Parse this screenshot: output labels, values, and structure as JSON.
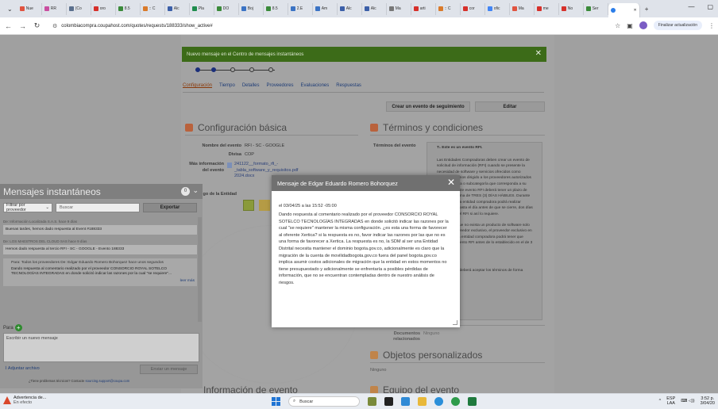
{
  "browser": {
    "tabs": [
      {
        "label": "Nue",
        "color": "#e0533f"
      },
      {
        "label": "RR",
        "color": "#c94ea0"
      },
      {
        "label": "(Co",
        "color": "#5a6f8d"
      },
      {
        "label": "oro",
        "color": "#d6302a"
      },
      {
        "label": "8.5",
        "color": "#3a8a3a"
      },
      {
        "label": ":: C",
        "color": "#d97a2a"
      },
      {
        "label": "Alc",
        "color": "#3b5fa8"
      },
      {
        "label": "Pla",
        "color": "#1e8c4d"
      },
      {
        "label": "DO",
        "color": "#3a8a3a"
      },
      {
        "label": "Boj",
        "color": "#3b73c4"
      },
      {
        "label": "8.5",
        "color": "#3a8a3a"
      },
      {
        "label": "2.E",
        "color": "#3b73c4"
      },
      {
        "label": "Am",
        "color": "#3b73c4"
      },
      {
        "label": "Alc",
        "color": "#3b5fa8"
      },
      {
        "label": "Alc",
        "color": "#3b5fa8"
      },
      {
        "label": "Ma",
        "color": "#777777"
      },
      {
        "label": "arti",
        "color": "#d6302a"
      },
      {
        "label": ":: C",
        "color": "#d97a2a"
      },
      {
        "label": "cor",
        "color": "#d6302a"
      },
      {
        "label": "ofic",
        "color": "#4285f4"
      },
      {
        "label": "Ma",
        "color": "#e0533f"
      },
      {
        "label": "me",
        "color": "#d6302a"
      },
      {
        "label": "No",
        "color": "#d6302a"
      },
      {
        "label": "Ser",
        "color": "#3a8a3a"
      }
    ],
    "active_tab_label": "",
    "new_tab": "+",
    "url": "colombiacompra.coupahost.com/quotes/requests/188333/show_active#",
    "update_button": "Finalizar actualización"
  },
  "banner": {
    "text": "Nuevo mensaje en el Centro de mensajes instantáneos",
    "close": "✕"
  },
  "wizard_nav": [
    "Configuración",
    "Tiempo",
    "Detalles",
    "Proveedores",
    "Evaluaciones",
    "Respuestas"
  ],
  "actions": {
    "follow_up": "Crear un evento de seguimiento",
    "edit": "Editar"
  },
  "config": {
    "title": "Configuración básica",
    "event_name_label": "Nombre del evento",
    "event_name": "RFI - SC - GOOGLE",
    "currency_label": "Divisa",
    "currency": "COP",
    "more_info_label": "Más información del evento",
    "attachment": "241122__formato_rfi_-_tabla_software_y_requisitos.pdf 2024.docx",
    "entity_label": "go de la Entidad"
  },
  "terms": {
    "title": "Términos y condiciones",
    "label": "Términos del evento",
    "header": "T₁ Este es un evento RFI.",
    "paragraphs": [
      "Las Entidades Compradoras deben crear un evento de solicitud de información (RFI) cuando se presente la necesidad de software y servicios ofrecidos como complementarios dirigido a los proveedores autorizados de la categoría o subcategoría que corresponda a su necesidad. Este evento RFI deberá tener un plazo de duración mínima de TRES (3) DÍAS HÁBILES. Durante este tiempo, la entidad compradora podrá realizar preguntas y hasta el día antes de que se cierre, dos días hábiles para el RFI si así lo requiere.",
      "En caso de que no exista un producto de software solo tenga un proveedor exclusivo, el proveedor exclusivo en el catálogo, la entidad compradora podrá tener que terminar el evento RFI antes de lo establecido en el de 3 días hábiles.",
      "...",
      "El proveedor deberá aceptar los términos de forma"
    ],
    "docs_label": "Documentos relacionados",
    "docs_value": "Ninguno"
  },
  "custom_objects": {
    "title": "Objetos personalizados",
    "value": "Ninguno"
  },
  "bottom_sections": {
    "left": "Información de evento",
    "right": "Equipo del evento"
  },
  "chat": {
    "title": "Mensajes instantáneos",
    "badge": "0",
    "filter_label": "Filtrar por proveedor",
    "search_placeholder": "Buscar",
    "export_label": "Exportar",
    "messages": [
      {
        "meta": "De: Información Localizada S.A.S. hace 9 días",
        "text": "Buenas tardes, hemos dado respuesta al Event #188333"
      },
      {
        "meta": "De: LOS MAESTROS DEL CLOUD SAS hace 9 días",
        "text": "Hemos dado respuesta al tercio RFI - SC - GOOGLE - Evento 188333"
      }
    ],
    "expanded": {
      "meta": "Para: Todos los proveedores De: Edgar Eduardo Romero Bohorquez hace unos segundos",
      "text": "Dando respuesta al comentario realizado por el proveedor CONSORCIO ROYAL SOTELCO TECNOLOGÍAS INTEGRADAS en donde solicitó indicar las razones por la cual \"se requiere\"...",
      "more": "leer más"
    },
    "to_label": "Para",
    "new_placeholder": "Escribir un nuevo mensaje",
    "attach_label": "Adjuntar archivo",
    "send_label": "Enviar un mensaje",
    "support_text": "¿Tiene problemas técnicos? Contacte",
    "support_email": "sourcing.support@coupa.com"
  },
  "modal": {
    "title": "Mensaje de Edgar Eduardo Romero Bohorquez",
    "close": "✕",
    "date": "el 03/04/25 a las 15:52 -05:00",
    "body": "Dando respuesta al comentario realizado por el proveedor CONSORCIO ROYAL SOTELCO TECNOLOGÍAS INTEGRADAS en donde solicitó indicar las razones por la cual \"se requiere\" mantener la misma configuración. ¿es esta una forma de favorecer al oferente Xertica? si la respuesta es no, favor indicar las razones por las que no es una forma de favorecer a Xertica. La respuesta es no, la SDM al ser una Entidad Distrital necesita mantener el dominio bogota.gov.co, adicionalmente es claro que la migración de la cuenta de movilidadbogota.gov.co fuera del panel bogota.gov.co implica asumir costos adicionales de migración que la entidad en estos momentos no tiene presupuestado y adicionalmente se enfrentaría a posibles pérdidas de información, que no se encuentran contempladas dentro de nuestro análisis de riesgos."
  },
  "taskbar": {
    "warning_title": "Advertencia de...",
    "warning_sub": "En efecto",
    "search_placeholder": "Buscar",
    "lang_top": "ESP",
    "lang_bottom": "LAA",
    "time": "3:52 p.",
    "date": "3/04/20"
  }
}
